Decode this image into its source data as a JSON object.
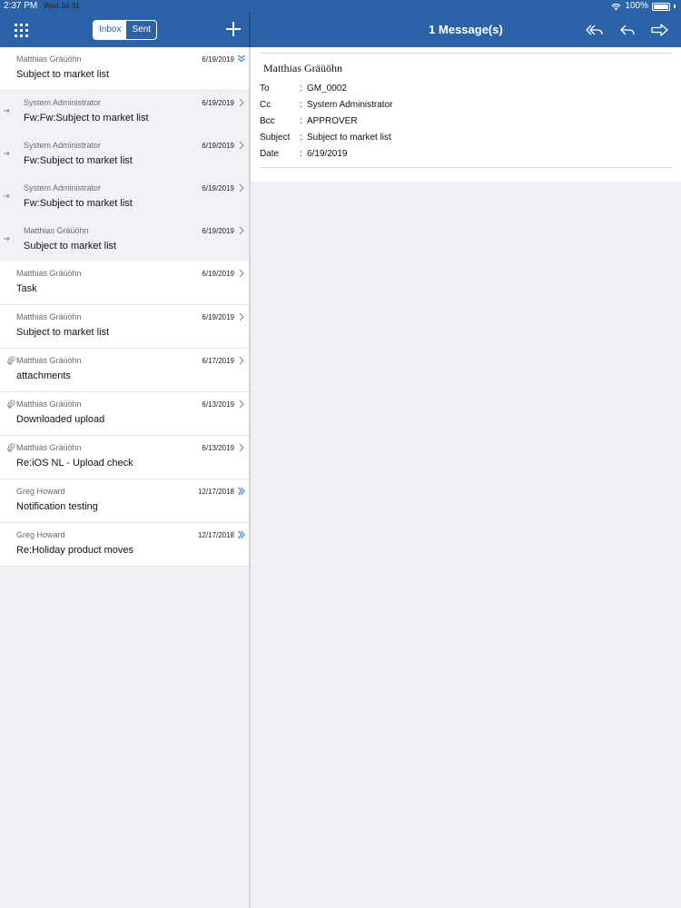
{
  "status_bar": {
    "time": "2:37 PM",
    "date": "Wed Jul 31",
    "battery": "100%"
  },
  "toolbar": {
    "segments": [
      "Inbox",
      "Sent"
    ],
    "selected_segment": "Inbox",
    "title": "1 Message(s)"
  },
  "messages": [
    {
      "sender": "Matthias Gräüöhn",
      "date": "6/19/2019",
      "subject": "Subject to market list",
      "indicator": "expand-double-chevron",
      "thread_child": false,
      "attachment": false,
      "selected": true
    },
    {
      "sender": "System Administrator",
      "date": "6/19/2019",
      "subject": "Fw:Fw:Subject to market list",
      "indicator": "chevron",
      "thread_child": true,
      "attachment": false
    },
    {
      "sender": "System Administrator",
      "date": "6/19/2019",
      "subject": "Fw:Subject to market list",
      "indicator": "chevron",
      "thread_child": true,
      "attachment": false
    },
    {
      "sender": "System Administrator",
      "date": "6/19/2019",
      "subject": "Fw:Subject to market list",
      "indicator": "chevron",
      "thread_child": true,
      "attachment": false
    },
    {
      "sender": "Matthias Gräüöhn",
      "date": "6/19/2019",
      "subject": "Subject to market list",
      "indicator": "chevron",
      "thread_child": true,
      "attachment": false
    },
    {
      "sender": "Matthias Gräüöhn",
      "date": "6/19/2019",
      "subject": "Task",
      "indicator": "chevron",
      "thread_child": false,
      "attachment": false
    },
    {
      "sender": "Matthias Gräüöhn",
      "date": "6/19/2019",
      "subject": "Subject to market list",
      "indicator": "chevron",
      "thread_child": false,
      "attachment": false
    },
    {
      "sender": "Matthias Gräüöhn",
      "date": "6/17/2019",
      "subject": "attachments",
      "indicator": "chevron",
      "thread_child": false,
      "attachment": true
    },
    {
      "sender": "Matthias Gräüöhn",
      "date": "6/13/2019",
      "subject": "Downloaded upload",
      "indicator": "chevron",
      "thread_child": false,
      "attachment": true
    },
    {
      "sender": "Matthias Gräüöhn",
      "date": "6/13/2019",
      "subject": "Re:iOS NL - Upload check",
      "indicator": "chevron",
      "thread_child": false,
      "attachment": true
    },
    {
      "sender": "Greg Howard",
      "date": "12/17/2018",
      "subject": "Notification testing",
      "indicator": "double-chevron",
      "thread_child": false,
      "attachment": false
    },
    {
      "sender": "Greg Howard",
      "date": "12/17/2018",
      "subject": "Re:Holiday product moves",
      "indicator": "double-chevron",
      "thread_child": false,
      "attachment": false
    }
  ],
  "detail": {
    "from": "Matthias Gräüöhn",
    "fields": [
      {
        "key": "To",
        "value": "GM_0002"
      },
      {
        "key": "Cc",
        "value": "System Administrator"
      },
      {
        "key": "Bcc",
        "value": "APPROVER"
      },
      {
        "key": "Subject",
        "value": "Subject to market list"
      },
      {
        "key": "Date",
        "value": "6/19/2019"
      }
    ]
  },
  "colors": {
    "accent": "#2c62a8",
    "link_blue": "#2f86d6",
    "thread_bg": "#f2f2f6"
  },
  "icons": [
    "grid-icon",
    "plus-icon",
    "reply-all-icon",
    "reply-icon",
    "forward-icon",
    "chevron-right-icon",
    "double-chevron-icon",
    "paperclip-icon",
    "thread-arrow-icon",
    "wifi-icon",
    "battery-icon"
  ]
}
